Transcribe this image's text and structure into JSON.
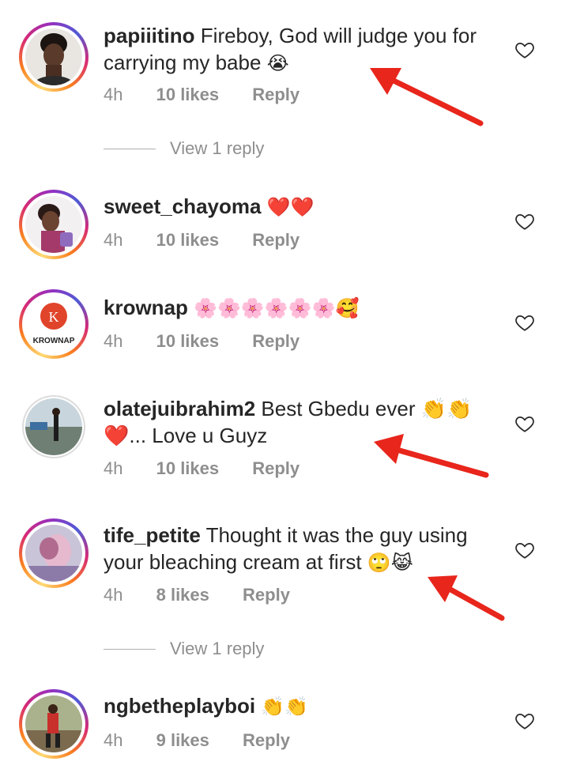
{
  "comments": [
    {
      "username": "papiiitino",
      "text": "Fireboy, God will judge you for carrying my babe",
      "emoji": "😭",
      "time": "4h",
      "likes": "10 likes",
      "reply": "Reply"
    },
    {
      "username": "sweet_chayoma",
      "text": "",
      "emoji": "❤️❤️",
      "time": "4h",
      "likes": "10 likes",
      "reply": "Reply"
    },
    {
      "username": "krownap",
      "text": "",
      "emoji": "🌸🌸🌸🌸🌸🌸🥰",
      "time": "4h",
      "likes": "10 likes",
      "reply": "Reply",
      "avatar_text": "KROWNAP",
      "avatar_letter": "K"
    },
    {
      "username": "olatejuibrahim2",
      "text": "Best Gbedu ever 👏👏 ❤️... Love u Guyz",
      "emoji": "",
      "time": "4h",
      "likes": "10 likes",
      "reply": "Reply"
    },
    {
      "username": "tife_petite",
      "text": "Thought it was the guy using your bleaching cream at first",
      "emoji": "🙄😹",
      "time": "4h",
      "likes": "8 likes",
      "reply": "Reply"
    },
    {
      "username": "ngbetheplayboi",
      "text": "",
      "emoji": "👏👏",
      "time": "4h",
      "likes": "9 likes",
      "reply": "Reply"
    }
  ],
  "view_replies": [
    "View 1 reply",
    "View 1 reply"
  ],
  "colors": {
    "arrow": "#e8261c",
    "meta": "#8e8e8e",
    "text": "#262626"
  }
}
